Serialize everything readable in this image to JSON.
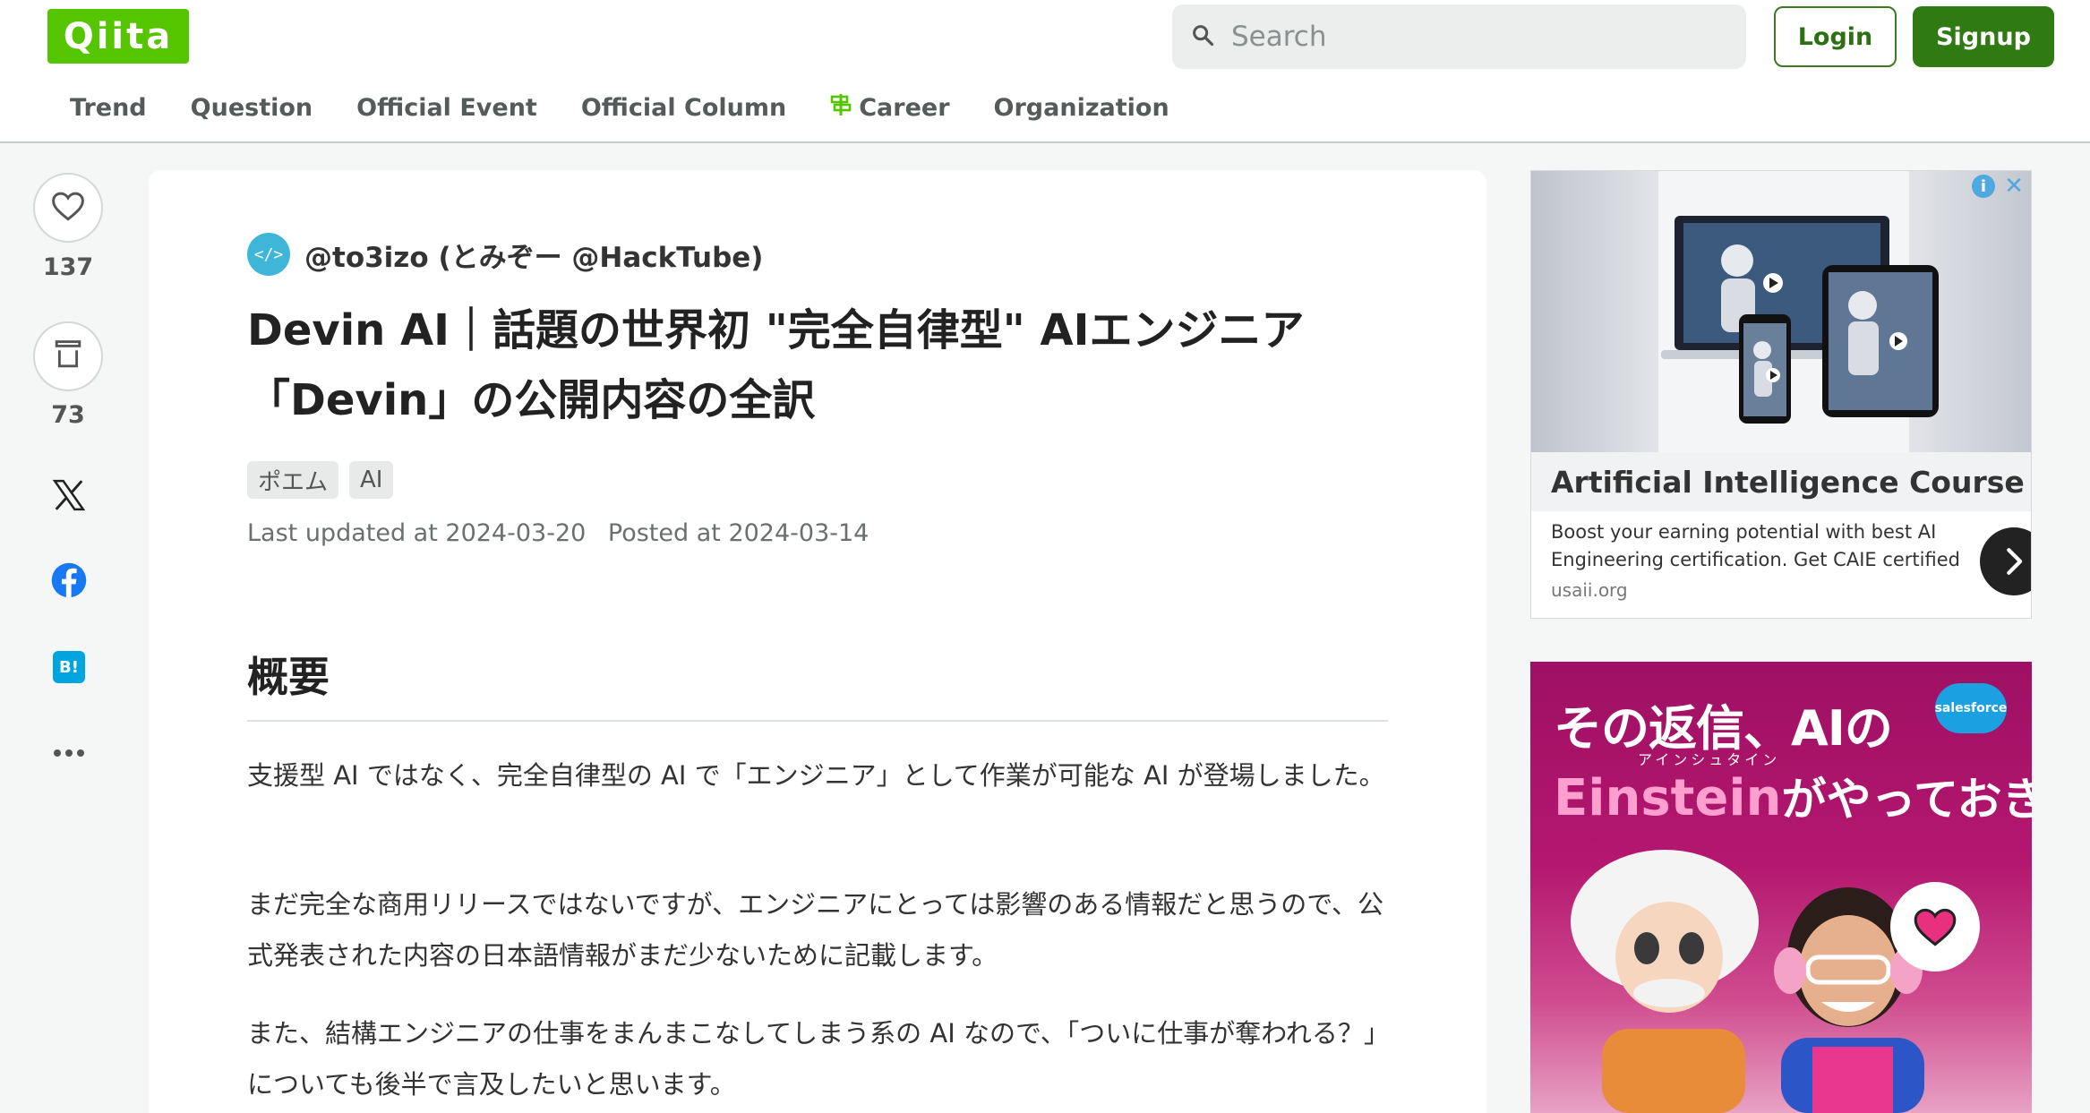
{
  "header": {
    "logo_text": "Qiita",
    "search_placeholder": "Search",
    "login_label": "Login",
    "signup_label": "Signup",
    "brand_color": "#55c500"
  },
  "nav": [
    {
      "label": "Trend"
    },
    {
      "label": "Question"
    },
    {
      "label": "Official Event"
    },
    {
      "label": "Official Column"
    },
    {
      "label": "Career",
      "icon": "career-icon"
    },
    {
      "label": "Organization"
    }
  ],
  "rail": {
    "like_count": "137",
    "stock_count": "73",
    "icons": [
      "heart-icon",
      "stock-icon",
      "x-icon",
      "facebook-icon",
      "hatena-bookmark-icon",
      "more-icon"
    ],
    "hatena_label": "B!"
  },
  "article": {
    "author": "@to3izo (とみぞー @HackTube)",
    "avatar_text": "</>",
    "title": "Devin AI｜話題の世界初 \"完全自律型\" AIエンジニア「Devin」の公開内容の全訳",
    "tags": [
      "ポエム",
      "AI"
    ],
    "last_updated": "Last updated at 2024-03-20",
    "posted": "Posted at 2024-03-14",
    "section_heading": "概要",
    "paragraphs": [
      "支援型 AI ではなく、完全自律型の AI で「エンジニア」として作業が可能な AI が登場しました。",
      "まだ完全な商用リリースではないですが、エンジニアにとっては影響のある情報だと思うので、公式発表された内容の日本語情報がまだ少ないために記載します。",
      "また、結構エンジニアの仕事をまんまこなしてしまう系の AI なので、「ついに仕事が奪われる？」についても後半で言及したいと思います。"
    ]
  },
  "ads": {
    "ad1": {
      "title": "Artificial Intelligence Course",
      "description": "Boost your earning potential with best AI Engineering certification. Get CAIE certified",
      "domain": "usaii.org",
      "info_label": "i",
      "close_label": "✕"
    },
    "ad2": {
      "headline": "その返信、AIの",
      "ruby": "アインシュタイン",
      "sub_emphasis": "Einstein",
      "sub_rest": "がやっておきます。",
      "brand_badge": "salesforce"
    }
  }
}
